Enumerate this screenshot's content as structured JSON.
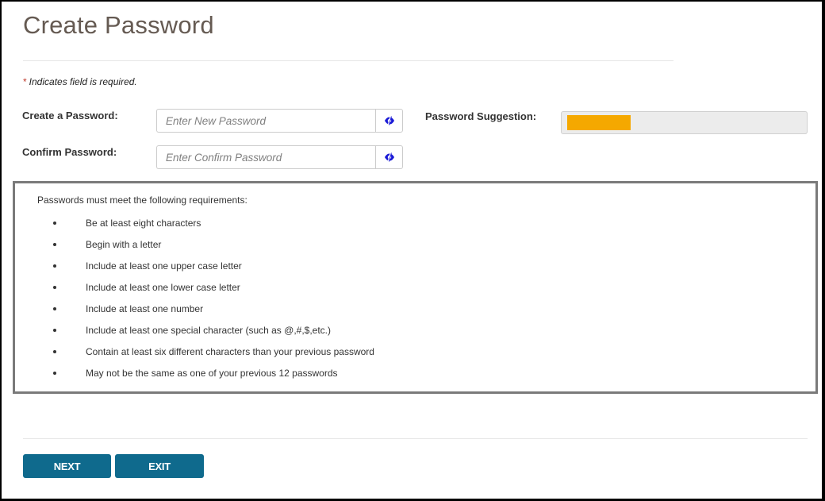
{
  "page": {
    "title": "Create Password"
  },
  "required_note": {
    "asterisk": "*",
    "text": "Indicates field is required."
  },
  "fields": {
    "new_password": {
      "label": "Create a Password:",
      "placeholder": "Enter New Password",
      "value": "",
      "toggle_icon": "eye-slash-icon"
    },
    "confirm_password": {
      "label": "Confirm Password:",
      "placeholder": "Enter Confirm Password",
      "value": "",
      "toggle_icon": "eye-slash-icon"
    }
  },
  "suggestion": {
    "label": "Password Suggestion:",
    "strength_fraction": 0.27,
    "fill_color": "#f5a800",
    "track_color": "#ececec"
  },
  "requirements": {
    "intro": "Passwords must meet the following requirements:",
    "items": [
      "Be at least eight characters",
      "Begin with a letter",
      "Include at least one upper case letter",
      "Include at least one lower case letter",
      "Include at least one number",
      "Include at least one special character (such as @,#,$,etc.)",
      "Contain at least six different characters than your previous password",
      "May not be the same as one of your previous 12 passwords"
    ]
  },
  "buttons": {
    "next": "NEXT",
    "exit": "EXIT",
    "color": "#0f6a8d"
  },
  "colors": {
    "icon_blue": "#1a1ad6",
    "title": "#655a52"
  }
}
